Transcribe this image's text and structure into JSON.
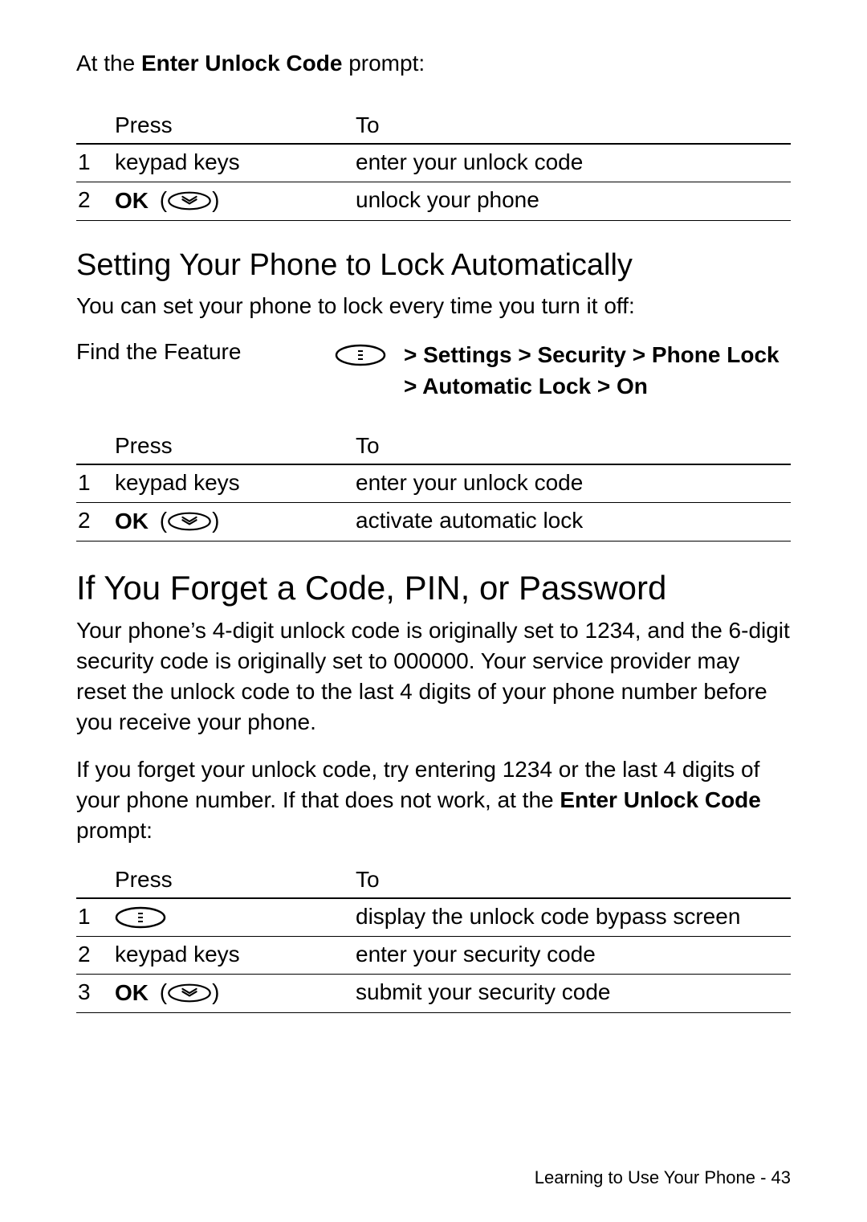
{
  "intro1_pre": "At the ",
  "intro1_bold": "Enter Unlock Code",
  "intro1_post": " prompt:",
  "table_headers": {
    "press": "Press",
    "to": "To"
  },
  "table1": [
    {
      "n": "1",
      "press_type": "text",
      "press": "keypad keys",
      "to": "enter your unlock code"
    },
    {
      "n": "2",
      "press_type": "ok",
      "press": "OK",
      "to": "unlock your phone"
    }
  ],
  "subhead1": "Setting Your Phone to Lock Automatically",
  "body1": "You can set your phone to lock every time you turn it off:",
  "feature_label": "Find the Feature",
  "feature_path_line1": "> Settings > Security > Phone Lock",
  "feature_path_line2": "> Automatic Lock > On",
  "table2": [
    {
      "n": "1",
      "press_type": "text",
      "press": "keypad keys",
      "to": "enter your unlock code"
    },
    {
      "n": "2",
      "press_type": "ok",
      "press": "OK",
      "to": "activate automatic lock"
    }
  ],
  "mainhead": "If You Forget a Code, PIN, or Password",
  "body2": "Your phone’s 4-digit unlock code is originally set to 1234, and the 6-digit security code is originally set to 000000. Your service provider may reset the unlock code to the last 4 digits of your phone number before you receive your phone.",
  "body3_pre": "If you forget your unlock code, try entering 1234 or the last 4 digits of your phone number. If that does not work, at the ",
  "body3_bold": "Enter Unlock Code",
  "body3_post": " prompt:",
  "table3": [
    {
      "n": "1",
      "press_type": "menu",
      "press": "",
      "to": "display the unlock code bypass screen"
    },
    {
      "n": "2",
      "press_type": "text",
      "press": "keypad keys",
      "to": "enter your security code"
    },
    {
      "n": "3",
      "press_type": "ok",
      "press": "OK",
      "to": "submit your security code"
    }
  ],
  "footer_text": "Learning to Use Your Phone - ",
  "footer_page": "43"
}
